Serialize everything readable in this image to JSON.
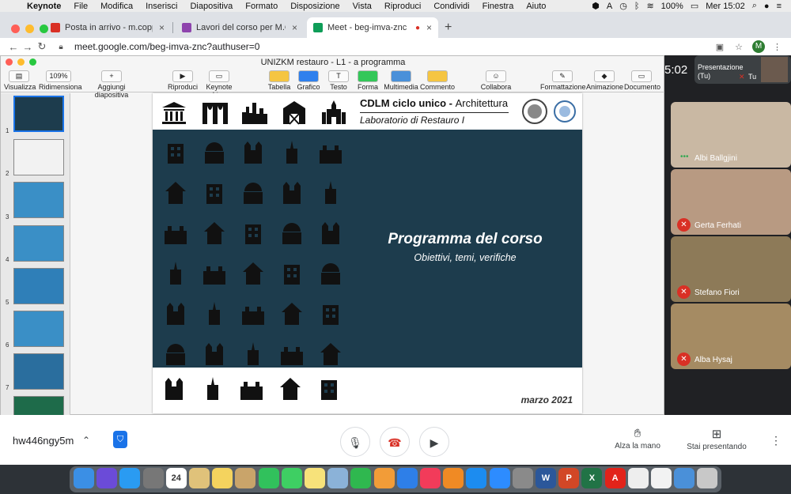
{
  "menubar": {
    "app": "Keynote",
    "items": [
      "File",
      "Modifica",
      "Inserisci",
      "Diapositiva",
      "Formato",
      "Disposizione",
      "Vista",
      "Riproduci",
      "Condividi",
      "Finestra",
      "Aiuto"
    ],
    "battery": "100%",
    "clock": "Mer 15:02"
  },
  "browser": {
    "tabs": [
      {
        "label": "Posta in arrivo - m.coppola@p",
        "icon_color": "#d93025"
      },
      {
        "label": "Lavori del corso per M.Coppol",
        "icon_color": "#8e44ad"
      },
      {
        "label": "Meet - beg-imva-znc",
        "icon_color": "#0f9d58"
      }
    ],
    "url": "meet.google.com/beg-imva-znc?authuser=0",
    "profile_initial": "M"
  },
  "keynote": {
    "title": "UNIZKM restauro - L1 - a programma",
    "zoom": "109%",
    "toolbar": [
      "Visualizza",
      "Ridimensiona",
      "Aggiungi diapositiva",
      "Riproduci",
      "Keynote Live",
      "Tabella",
      "Grafico",
      "Testo",
      "Forma",
      "Multimedia",
      "Commento",
      "Collabora",
      "Formattazione",
      "Animazione",
      "Documento"
    ],
    "slide_numbers": [
      "1",
      "2",
      "3",
      "4",
      "5",
      "6",
      "7"
    ],
    "slide": {
      "header_line1_bold": "CDLM ciclo unico - ",
      "header_line1_rest": "Architettura",
      "header_line2": "Laboratorio di Restauro I",
      "title": "Programma del corso",
      "subtitle": "Obiettivi, temi, verifiche",
      "date": "marzo 2021"
    }
  },
  "meet": {
    "timer": "5:02",
    "presenter": {
      "line1": "Presentazione",
      "line2": "(Tu)",
      "you": "Tu"
    },
    "participants": [
      {
        "name": "Albi Ballgjini",
        "muted": false
      },
      {
        "name": "Gerta Ferhati",
        "muted": true
      },
      {
        "name": "Stefano Fiori",
        "muted": true
      },
      {
        "name": "Alba Hysaj",
        "muted": true
      }
    ],
    "meeting_code": "hw446ngy5m",
    "raise_hand": "Alza la mano",
    "presenting": "Stai presentando"
  },
  "dock": {
    "calendar_day": "24"
  }
}
